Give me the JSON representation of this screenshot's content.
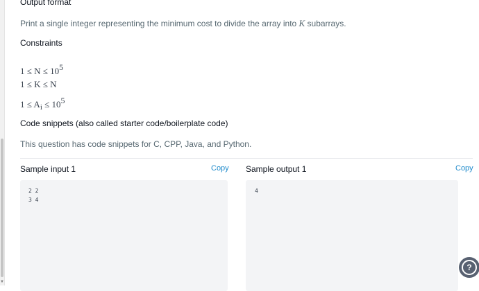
{
  "sections": {
    "output_format_heading": "Output format",
    "output_format_text_before": "Print a single integer representing the minimum cost to divide the array into ",
    "output_format_var": "K",
    "output_format_text_after": " subarrays.",
    "constraints_heading": "Constraints",
    "constraint_1": "1 ≤ N ≤ 10",
    "constraint_1_exp": "5",
    "constraint_2": "1 ≤ K ≤ N",
    "constraint_3_a": "1 ≤ A",
    "constraint_3_sub": "i",
    "constraint_3_b": " ≤ 10",
    "constraint_3_exp": "5",
    "snippets_heading": "Code snippets (also called starter code/boilerplate code)",
    "snippets_text": "This question has code snippets for C, CPP, Java, and Python."
  },
  "sample_input": {
    "title": "Sample input 1",
    "copy_label": "Copy",
    "lines": [
      "2 2",
      "3 4"
    ]
  },
  "sample_output": {
    "title": "Sample output 1",
    "copy_label": "Copy",
    "lines": [
      "4"
    ]
  },
  "help": {
    "icon": "question-icon",
    "label": "?"
  }
}
